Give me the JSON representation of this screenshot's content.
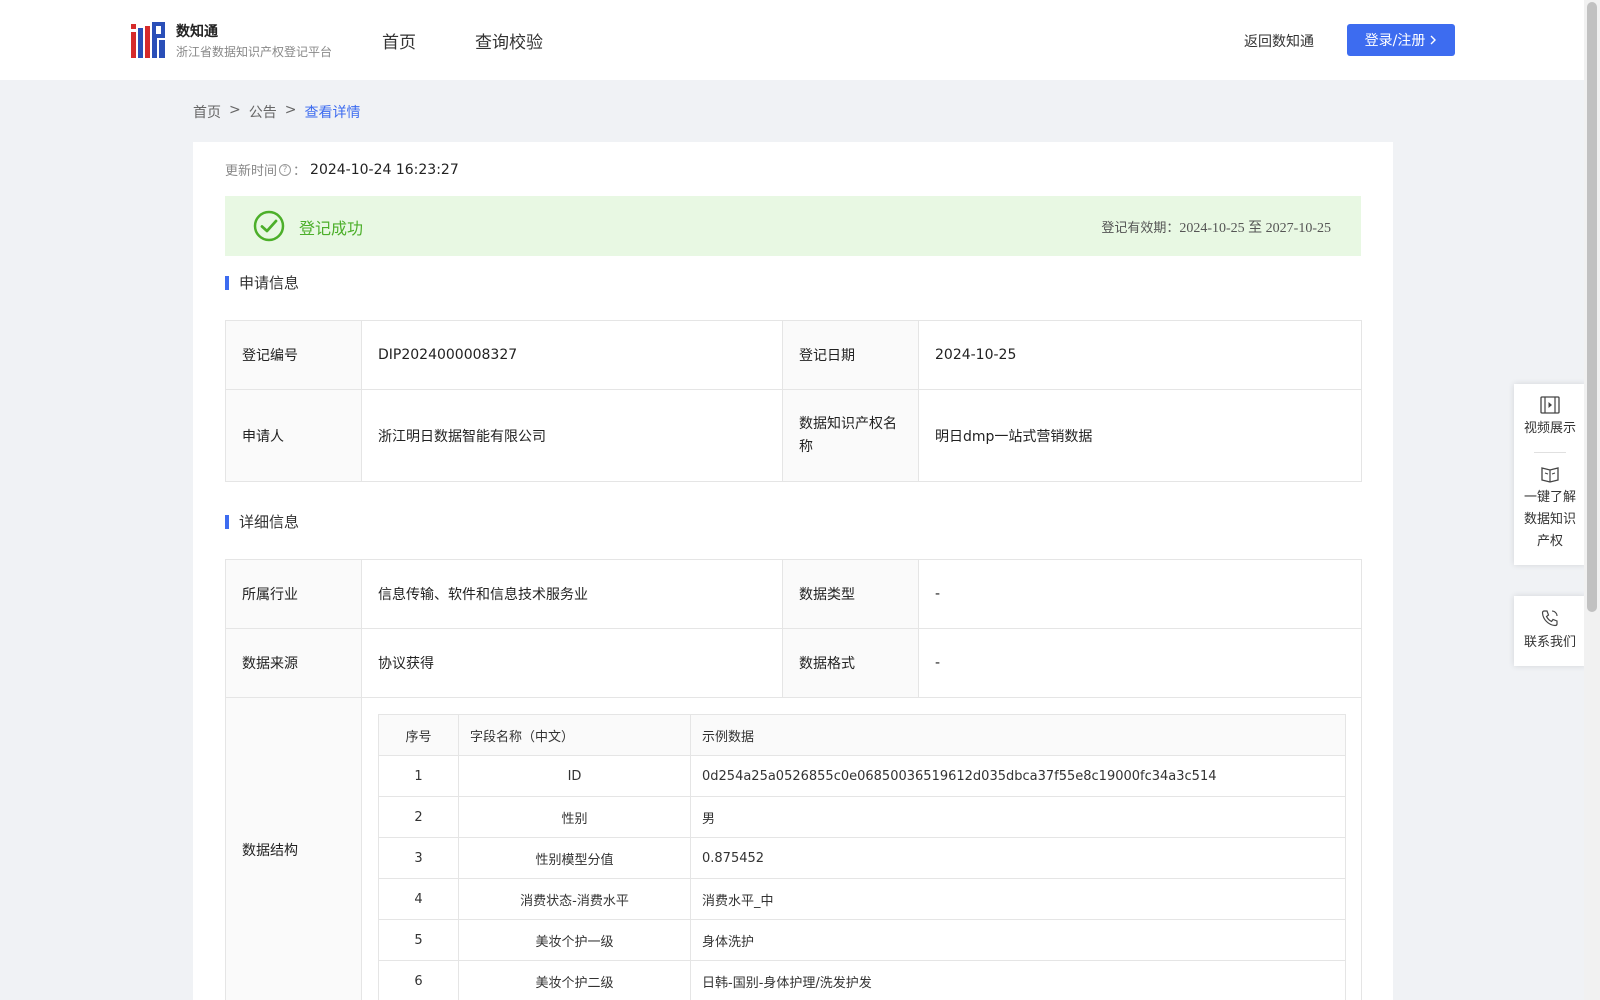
{
  "header": {
    "brand_title": "数知通",
    "brand_sub": "浙江省数据知识产权登记平台",
    "nav": [
      {
        "label": "首页"
      },
      {
        "label": "查询校验"
      }
    ],
    "back_link": "返回数知通",
    "login_label": "登录/注册"
  },
  "breadcrumb": {
    "items": [
      "首页",
      "公告"
    ],
    "current": "查看详情",
    "separator": ">"
  },
  "update": {
    "label": "更新时间",
    "colon": "：",
    "value": "2024-10-24 16:23:27"
  },
  "status": {
    "text": "登记成功",
    "validity_label": "登记有效期：",
    "validity_value": "2024-10-25 至 2027-10-25",
    "color": "#4caf2a"
  },
  "application": {
    "section_title": "申请信息",
    "rows": [
      {
        "l1": "登记编号",
        "v1": "DIP2024000008327",
        "l2": "登记日期",
        "v2": "2024-10-25"
      },
      {
        "l1": "申请人",
        "v1": "浙江明日数据智能有限公司",
        "l2": "数据知识产权名称",
        "v2": "明日dmp一站式营销数据"
      }
    ]
  },
  "details": {
    "section_title": "详细信息",
    "rows": [
      {
        "l1": "所属行业",
        "v1": "信息传输、软件和信息技术服务业",
        "l2": "数据类型",
        "v2": "-"
      },
      {
        "l1": "数据来源",
        "v1": "协议获得",
        "l2": "数据格式",
        "v2": "-"
      }
    ],
    "structure_label": "数据结构",
    "structure": {
      "headers": [
        "序号",
        "字段名称（中文）",
        "示例数据"
      ],
      "rows": [
        {
          "no": "1",
          "field": "ID",
          "sample": "0d254a25a0526855c0e06850036519612d035dbca37f55e8c19000fc34a3c514"
        },
        {
          "no": "2",
          "field": "性别",
          "sample": "男"
        },
        {
          "no": "3",
          "field": "性别模型分值",
          "sample": "0.875452"
        },
        {
          "no": "4",
          "field": "消费状态-消费水平",
          "sample": "消费水平_中"
        },
        {
          "no": "5",
          "field": "美妆个护一级",
          "sample": "身体洗护"
        },
        {
          "no": "6",
          "field": "美妆个护二级",
          "sample": "日韩-国别-身体护理/洗发护发"
        }
      ]
    }
  },
  "side_panel": {
    "video": "视频展示",
    "learn_lines": [
      "一键了解",
      "数据知识",
      "产权"
    ],
    "contact": "联系我们"
  },
  "colors": {
    "accent": "#3d6cf0",
    "success_bg": "#e8f8e3",
    "page_bg": "#f0f2f5"
  }
}
